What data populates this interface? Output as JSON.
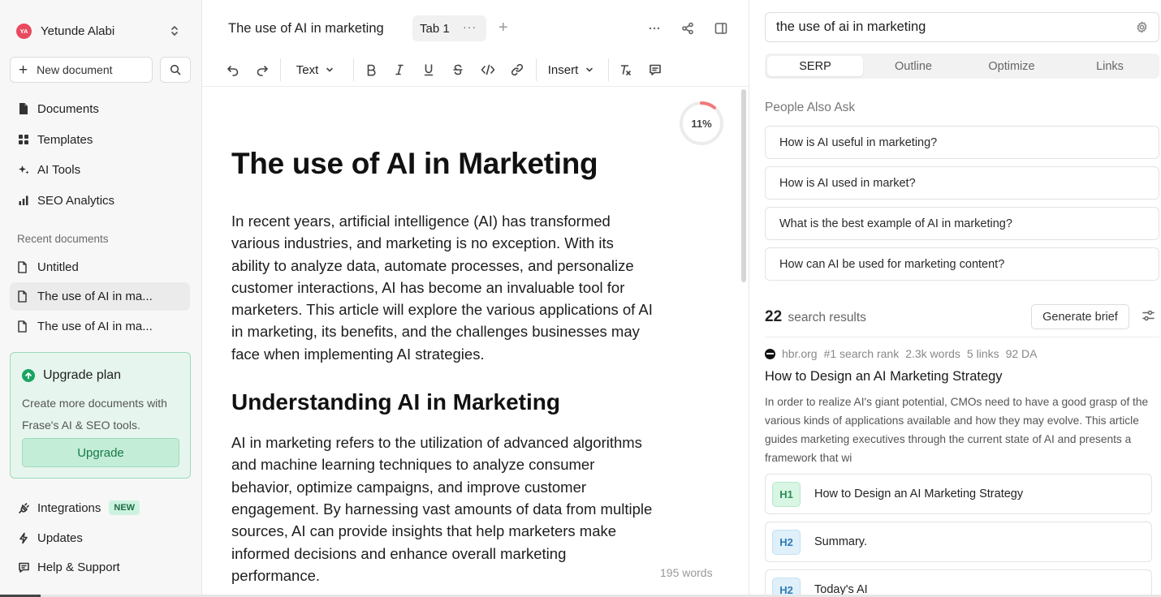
{
  "sidebar": {
    "user": {
      "initials": "YA",
      "name": "Yetunde Alabi"
    },
    "new_document": "New document",
    "nav": [
      {
        "label": "Documents",
        "icon": "document-icon"
      },
      {
        "label": "Templates",
        "icon": "grid-icon"
      },
      {
        "label": "AI Tools",
        "icon": "sparkle-icon"
      },
      {
        "label": "SEO Analytics",
        "icon": "bar-chart-icon"
      }
    ],
    "recent_label": "Recent documents",
    "recent": [
      {
        "label": "Untitled"
      },
      {
        "label": "The use of AI in ma..."
      },
      {
        "label": "The use of AI in ma..."
      }
    ],
    "upgrade": {
      "title": "Upgrade plan",
      "desc": "Create more documents with Frase's AI & SEO tools.",
      "button": "Upgrade"
    },
    "bottom": [
      {
        "label": "Integrations",
        "badge": "NEW"
      },
      {
        "label": "Updates"
      },
      {
        "label": "Help & Support"
      }
    ]
  },
  "editor": {
    "title": "The use of AI in marketing",
    "tab": "Tab 1",
    "tab_more": "···",
    "tab_add": "+",
    "toolbar": {
      "text_style": "Text",
      "insert": "Insert"
    },
    "progress": {
      "label": "11%",
      "value": 0.11
    },
    "h1": "The use of AI in Marketing",
    "p1": "In recent years, artificial intelligence (AI) has transformed various industries, and marketing is no exception. With its ability to analyze data, automate processes, and personalize customer interactions, AI has become an invaluable tool for marketers. This article will explore the various applications of AI in marketing, its benefits, and the challenges businesses may face when implementing AI strategies.",
    "h2": "Understanding AI in Marketing",
    "p2": "AI in marketing refers to the utilization of advanced algorithms and machine learning techniques to analyze consumer behavior, optimize campaigns, and improve customer engagement. By harnessing vast amounts of data from multiple sources, AI can provide insights that help marketers make informed decisions and enhance overall marketing performance.",
    "word_count": "195 words"
  },
  "panel": {
    "query": "the use of ai in marketing",
    "tabs": [
      "SERP",
      "Outline",
      "Optimize",
      "Links"
    ],
    "active_tab": "SERP",
    "paa_label": "People Also Ask",
    "paa": [
      "How is AI useful in marketing?",
      "How is AI used in market?",
      "What is the best example of AI in marketing?",
      "How can AI be used for marketing content?"
    ],
    "results": {
      "count": "22",
      "label": "search results",
      "generate": "Generate brief"
    },
    "result1": {
      "domain": "hbr.org",
      "rank": "#1 search rank",
      "words": "2.3k words",
      "links": "5 links",
      "da": "92 DA",
      "title": "How to Design an AI Marketing Strategy",
      "snippet": "In order to realize AI's giant potential, CMOs need to have a good grasp of the various kinds of applications available and how they may evolve. This article guides marketing executives through the current state of AI and presents a framework that wi",
      "headings": [
        {
          "tag": "H1",
          "text": "How to Design an AI Marketing Strategy"
        },
        {
          "tag": "H2",
          "text": "Summary."
        },
        {
          "tag": "H2",
          "text": "Today's AI"
        }
      ]
    }
  },
  "colors": {
    "brand_green": "#19a463",
    "avatar": "#e84a5f",
    "progress": "#f07a7a"
  }
}
